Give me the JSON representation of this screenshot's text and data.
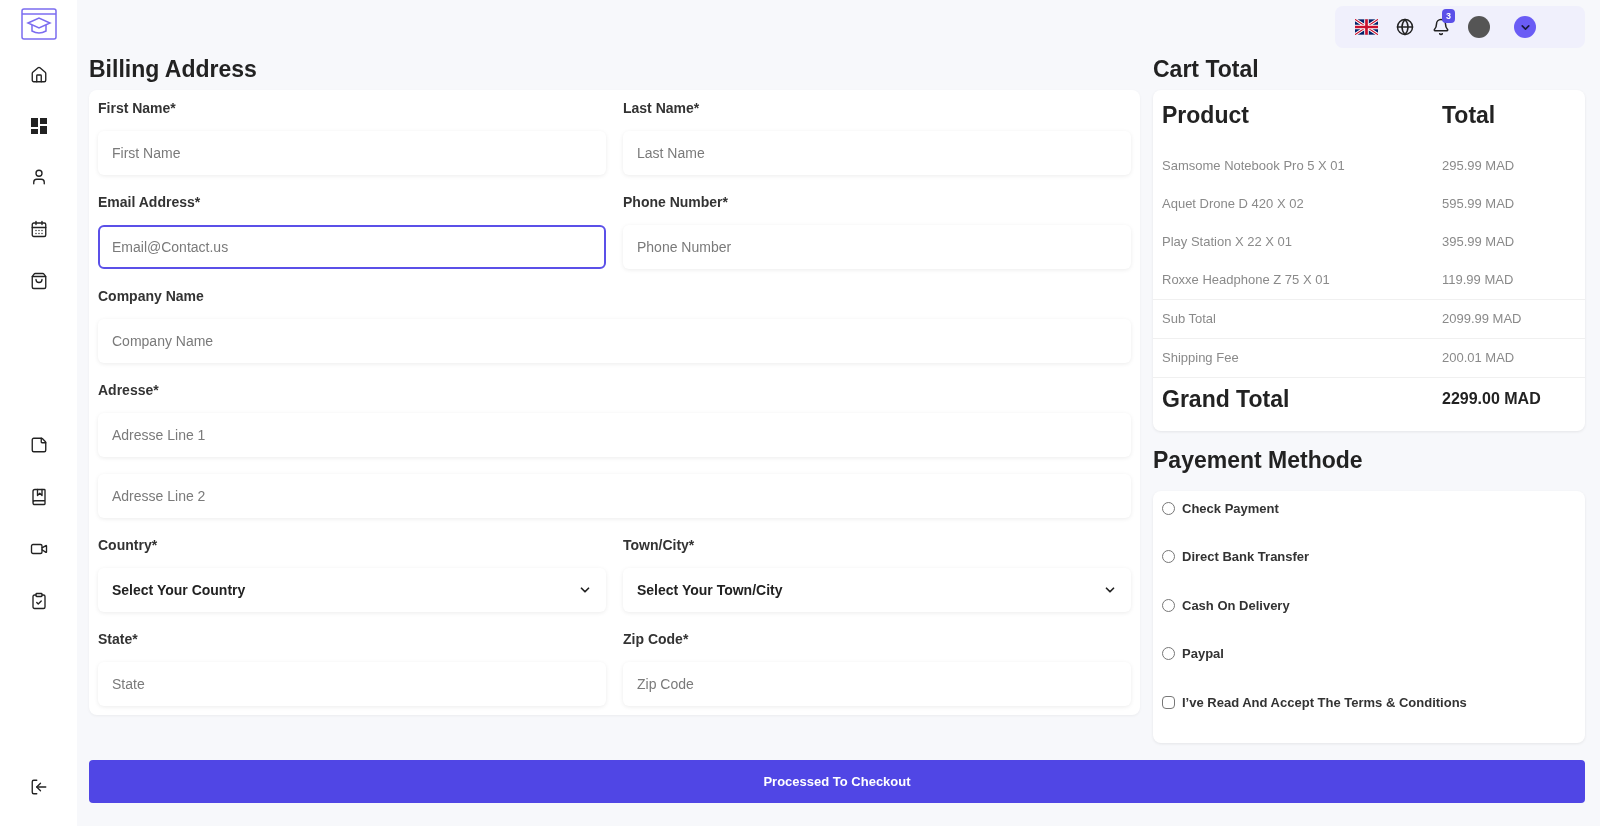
{
  "header": {
    "notification_count": "3"
  },
  "billing": {
    "title": "Billing Address",
    "rows": [
      {
        "fields": [
          {
            "kind": "input",
            "label": "First Name*",
            "placeholder": "First Name",
            "focused": false
          },
          {
            "kind": "input",
            "label": "Last Name*",
            "placeholder": "Last Name",
            "focused": false
          }
        ]
      },
      {
        "fields": [
          {
            "kind": "input",
            "label": "Email Address*",
            "placeholder": "Email@Contact.us",
            "focused": true
          },
          {
            "kind": "input",
            "label": "Phone Number*",
            "placeholder": "Phone Number",
            "focused": false
          }
        ]
      },
      {
        "fields": [
          {
            "kind": "input",
            "label": "Company Name",
            "placeholder": "Company Name",
            "focused": false
          }
        ]
      },
      {
        "fields": [
          {
            "kind": "input",
            "label": "Adresse*",
            "placeholder": "Adresse Line 1",
            "focused": false
          }
        ]
      },
      {
        "fields": [
          {
            "kind": "input",
            "placeholder": "Adresse Line 2",
            "focused": false
          }
        ]
      },
      {
        "fields": [
          {
            "kind": "select",
            "label": "Country*",
            "value": "Select Your Country",
            "focused": false
          },
          {
            "kind": "select",
            "label": "Town/City*",
            "value": "Select Your Town/City",
            "focused": false
          }
        ]
      },
      {
        "fields": [
          {
            "kind": "input",
            "label": "State*",
            "placeholder": "State",
            "focused": false
          },
          {
            "kind": "input",
            "label": "Zip Code*",
            "placeholder": "Zip Code",
            "focused": false
          }
        ]
      }
    ]
  },
  "cart": {
    "title": "Cart Total",
    "columns": [
      "Product",
      "Total"
    ],
    "items": [
      {
        "name": "Samsome Notebook Pro 5 X 01",
        "price": "295.99 MAD"
      },
      {
        "name": "Aquet Drone D 420 X 02",
        "price": "595.99 MAD"
      },
      {
        "name": "Play Station X 22 X 01",
        "price": "395.99 MAD"
      },
      {
        "name": "Roxxe Headphone Z 75 X 01",
        "price": "119.99 MAD"
      }
    ],
    "summary": [
      {
        "label": "Sub Total",
        "value": "2099.99 MAD"
      },
      {
        "label": "Shipping Fee",
        "value": "200.01 MAD"
      }
    ],
    "grand_total": {
      "label": "Grand Total",
      "value": "2299.00 MAD"
    }
  },
  "payment": {
    "title": "Payement Methode",
    "options": [
      {
        "label": "Check Payment",
        "selected": false
      },
      {
        "label": "Direct Bank Transfer",
        "selected": false
      },
      {
        "label": "Cash On Delivery",
        "selected": false
      },
      {
        "label": "Paypal",
        "selected": false
      }
    ],
    "terms": {
      "label": "I’ve Read And Accept The Terms & Conditions",
      "checked": false
    }
  },
  "checkout_button": "Processed To Checkout"
}
